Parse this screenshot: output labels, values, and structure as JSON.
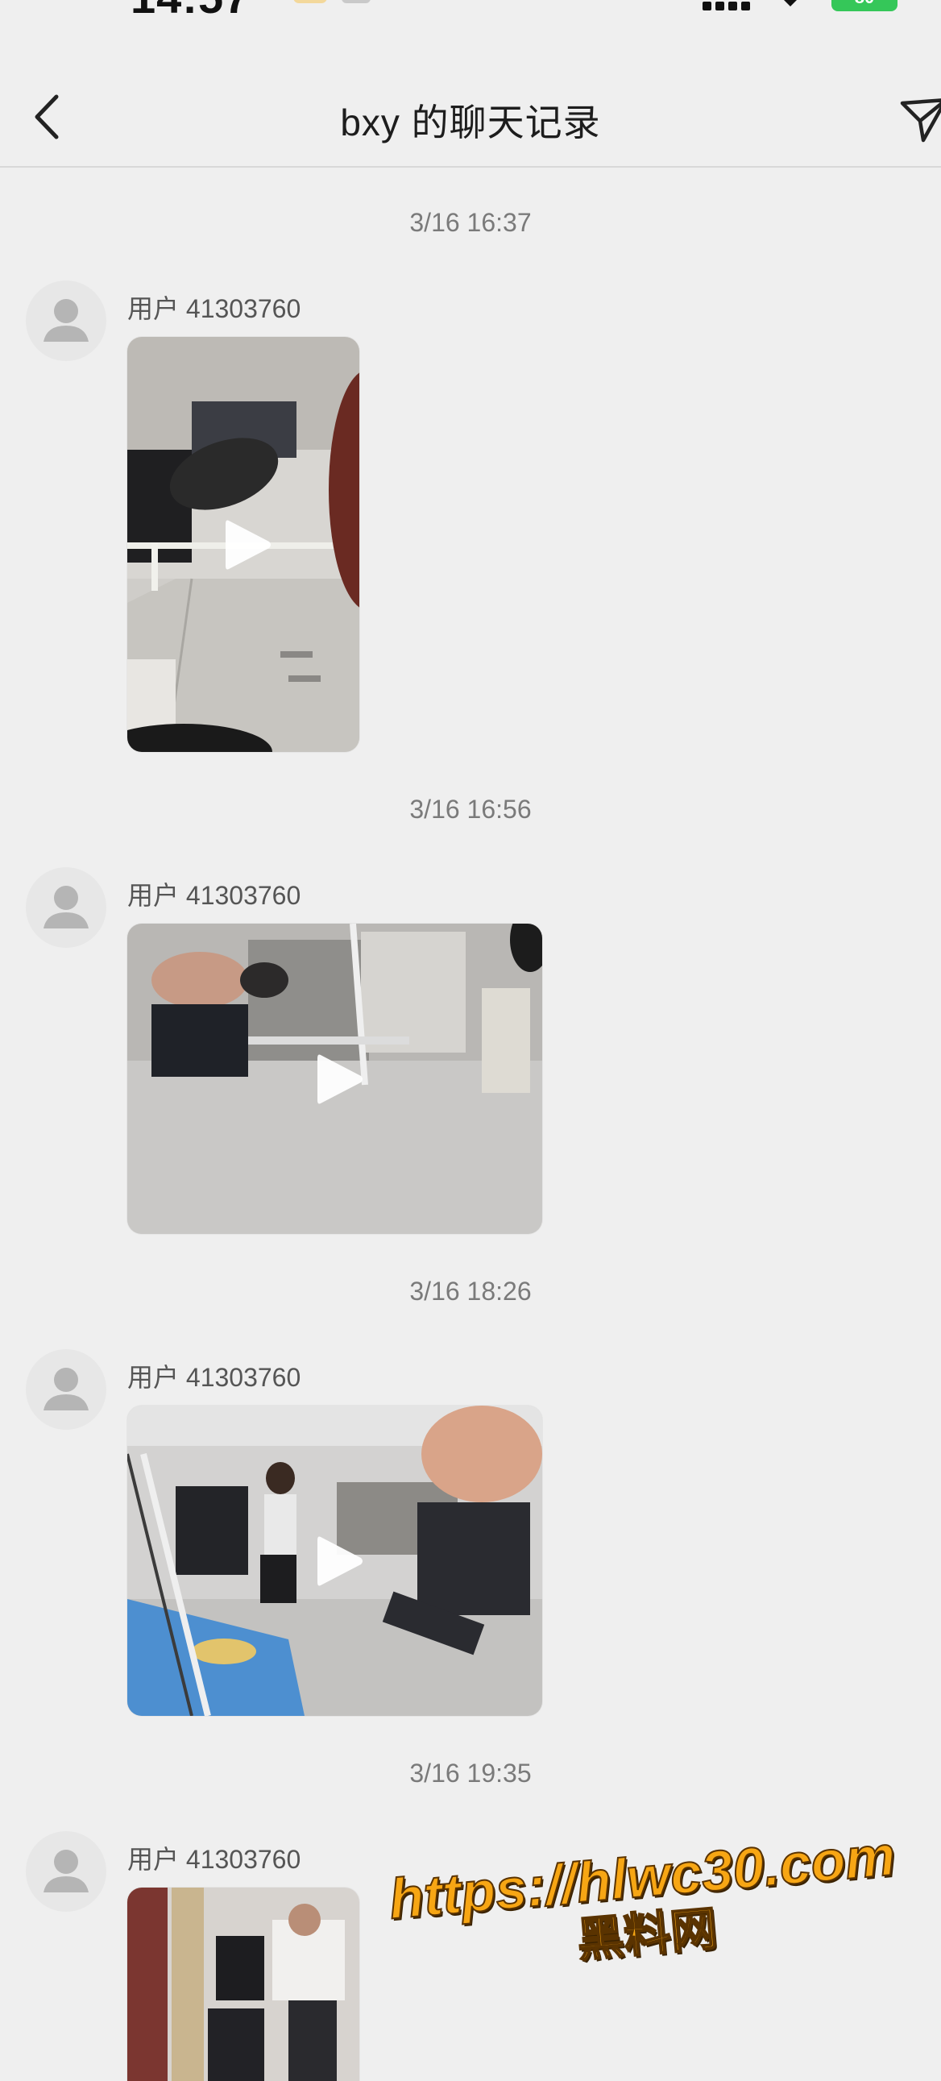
{
  "status_bar": {
    "time": "14:57",
    "battery": "80"
  },
  "header": {
    "title": "bxy 的聊天记录"
  },
  "messages": [
    {
      "timestamp": "3/16 16:37",
      "sender": "用户 41303760",
      "type": "video"
    },
    {
      "timestamp": "3/16 16:56",
      "sender": "用户 41303760",
      "type": "video"
    },
    {
      "timestamp": "3/16 18:26",
      "sender": "用户 41303760",
      "type": "video"
    },
    {
      "timestamp": "3/16 19:35",
      "sender": "用户 41303760",
      "type": "video"
    }
  ],
  "watermark": {
    "url": "https://hlwc30.com",
    "name": "黑料网"
  },
  "icons": {
    "back": "chevron-left-icon",
    "send": "paper-plane-icon",
    "avatar": "default-user-icon",
    "play": "play-icon"
  },
  "colors": {
    "background": "#efefef",
    "battery": "#35c759",
    "watermark": "#f7a614"
  }
}
